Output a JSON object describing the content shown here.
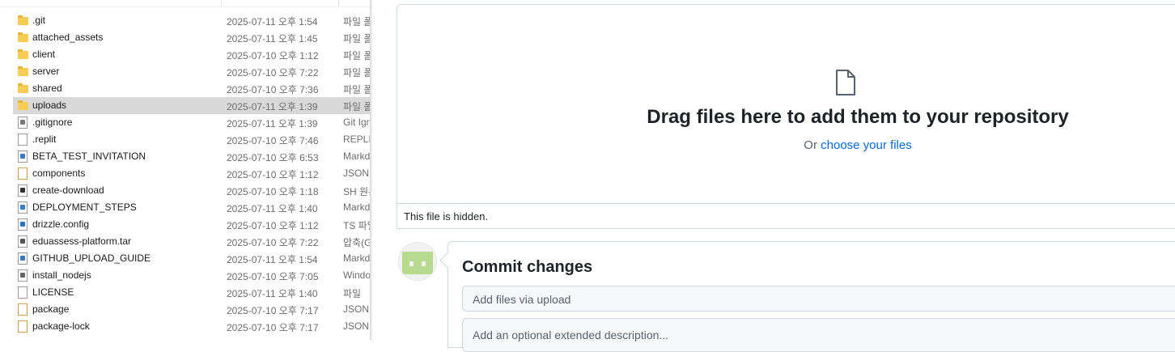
{
  "explorer": {
    "files": [
      {
        "name": ".git",
        "date": "2025-07-11 오후 1:54",
        "type": "파일 폴더",
        "icon": "folder-icon"
      },
      {
        "name": "attached_assets",
        "date": "2025-07-11 오후 1:45",
        "type": "파일 폴더",
        "icon": "folder-icon"
      },
      {
        "name": "client",
        "date": "2025-07-10 오후 1:12",
        "type": "파일 폴더",
        "icon": "folder-icon"
      },
      {
        "name": "server",
        "date": "2025-07-10 오후 7:22",
        "type": "파일 폴더",
        "icon": "folder-icon"
      },
      {
        "name": "shared",
        "date": "2025-07-10 오후 7:36",
        "type": "파일 폴더",
        "icon": "folder-icon"
      },
      {
        "name": "uploads",
        "date": "2025-07-11 오후 1:39",
        "type": "파일 폴더",
        "icon": "folder-icon",
        "selected": true
      },
      {
        "name": ".gitignore",
        "date": "2025-07-11 오후 1:39",
        "type": "Git Ignore",
        "icon": "config-file-icon"
      },
      {
        "name": ".replit",
        "date": "2025-07-10 오후 7:46",
        "type": "REPLIT",
        "icon": "file-icon"
      },
      {
        "name": "BETA_TEST_INVITATION",
        "date": "2025-07-10 오후 6:53",
        "type": "Markdown",
        "icon": "markdown-file-icon"
      },
      {
        "name": "components",
        "date": "2025-07-10 오후 1:12",
        "type": "JSON",
        "icon": "json-file-icon"
      },
      {
        "name": "create-download",
        "date": "2025-07-10 오후 1:18",
        "type": "SH 원본",
        "icon": "shell-file-icon"
      },
      {
        "name": "DEPLOYMENT_STEPS",
        "date": "2025-07-11 오후 1:40",
        "type": "Markdown",
        "icon": "markdown-file-icon"
      },
      {
        "name": "drizzle.config",
        "date": "2025-07-10 오후 1:12",
        "type": "TS 파일",
        "icon": "typescript-file-icon"
      },
      {
        "name": "eduassess-platform.tar",
        "date": "2025-07-10 오후 7:22",
        "type": "압축(Gz)",
        "icon": "archive-file-icon"
      },
      {
        "name": "GITHUB_UPLOAD_GUIDE",
        "date": "2025-07-11 오후 1:54",
        "type": "Markdown",
        "icon": "markdown-file-icon"
      },
      {
        "name": "install_nodejs",
        "date": "2025-07-10 오후 7:05",
        "type": "Windows",
        "icon": "batch-file-icon"
      },
      {
        "name": "LICENSE",
        "date": "2025-07-11 오후 1:40",
        "type": "파일",
        "icon": "file-icon"
      },
      {
        "name": "package",
        "date": "2025-07-10 오후 7:17",
        "type": "JSON",
        "icon": "json-file-icon"
      },
      {
        "name": "package-lock",
        "date": "2025-07-10 오후 7:17",
        "type": "JSON",
        "icon": "json-file-icon"
      }
    ]
  },
  "upload": {
    "drop_title": "Drag files here to add them to your repository",
    "drop_or": "Or ",
    "drop_link": "choose your files",
    "hidden_note": "This file is hidden.",
    "commit_title": "Commit changes",
    "commit_message_placeholder": "Add files via upload",
    "commit_description_placeholder": "Add an optional extended description..."
  },
  "colors": {
    "link": "#0969da",
    "selected_row": "#d9d9d9",
    "folder": "#f8cd56",
    "avatar": "#b7dc8f"
  }
}
